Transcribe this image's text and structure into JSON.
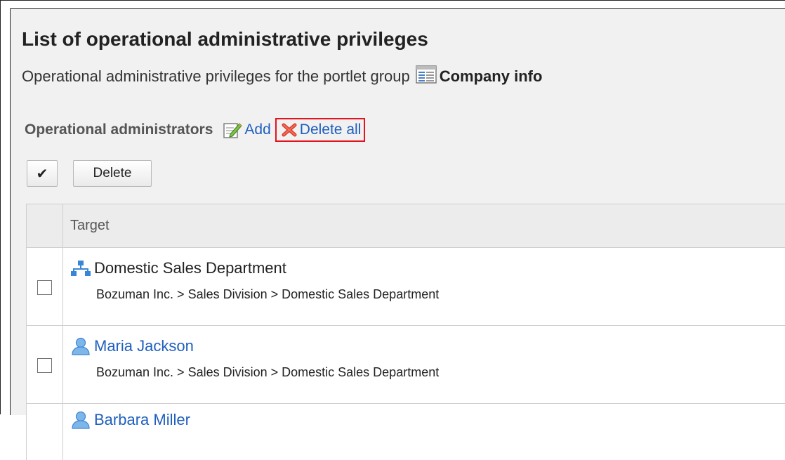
{
  "page": {
    "title": "List of operational administrative privileges",
    "description_prefix": "Operational administrative privileges for the portlet group",
    "group_name": "Company info"
  },
  "section": {
    "label": "Operational administrators",
    "add_label": "Add",
    "delete_all_label": "Delete all"
  },
  "toolbar": {
    "check_all_label": "✔",
    "delete_label": "Delete"
  },
  "table": {
    "header_target": "Target",
    "rows": [
      {
        "type": "organization",
        "name": "Domestic Sales Department",
        "path": "Bozuman Inc. > Sales Division > Domestic Sales Department"
      },
      {
        "type": "user",
        "name": "Maria Jackson",
        "path": "Bozuman Inc. > Sales Division > Domestic Sales Department"
      },
      {
        "type": "user",
        "name": "Barbara Miller",
        "path": ""
      }
    ]
  },
  "colors": {
    "link": "#1f5fbf",
    "highlight_box": "#e5131d",
    "panel_bg": "#f1f1f1",
    "header_bg": "#ececec"
  },
  "icons": [
    "portlet-group-icon",
    "add-edit-icon",
    "delete-x-icon",
    "organization-icon",
    "user-icon"
  ]
}
